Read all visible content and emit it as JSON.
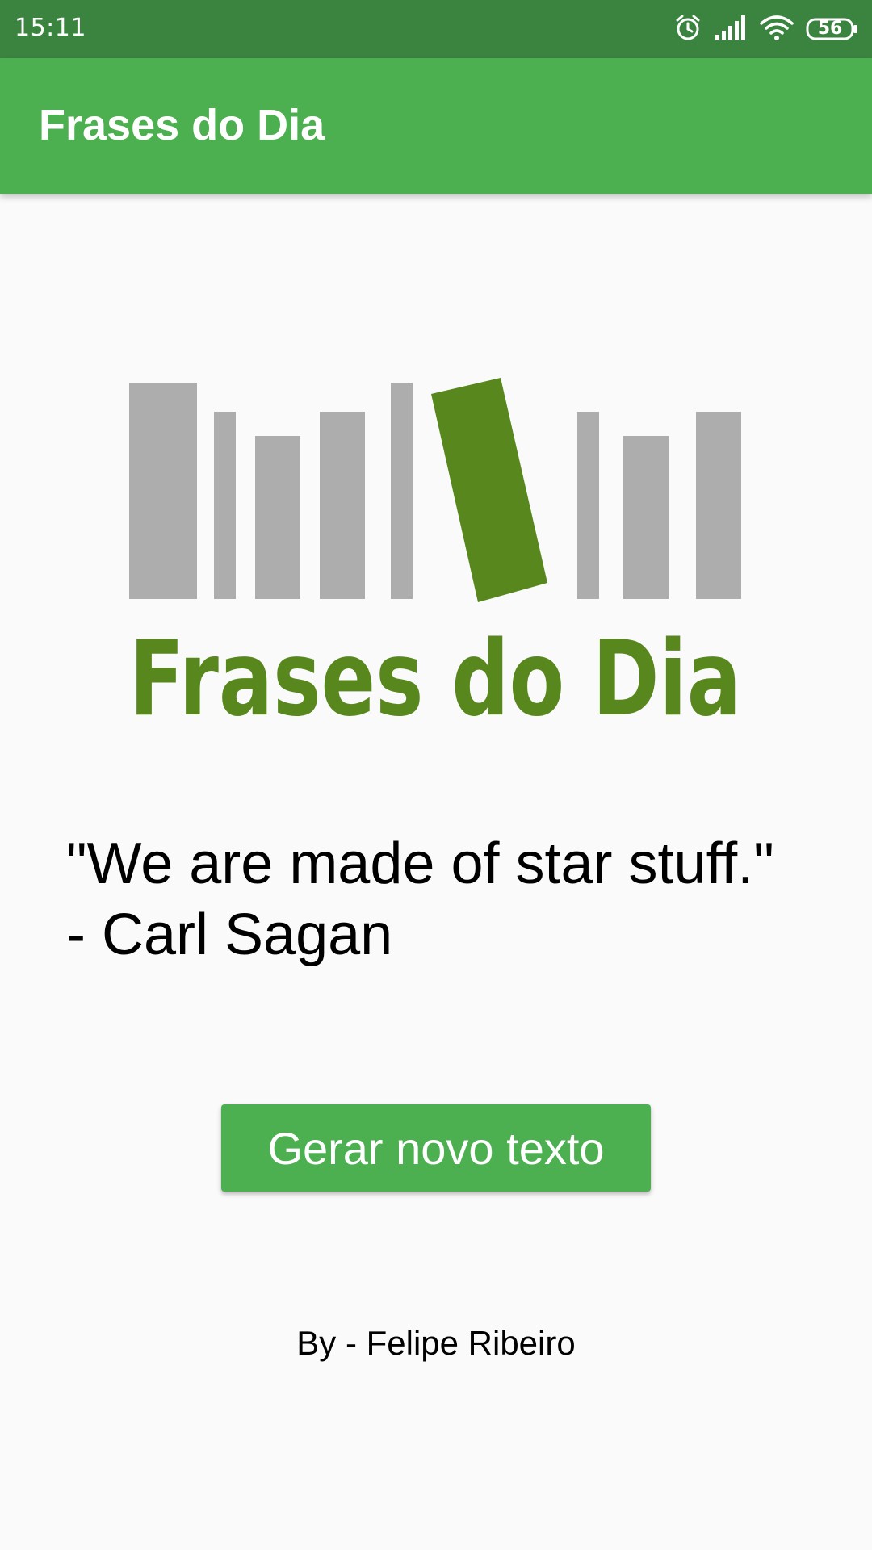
{
  "status_bar": {
    "time": "15:11",
    "battery_level": "56",
    "icons": [
      "alarm-icon",
      "signal-icon",
      "wifi-icon",
      "battery-icon"
    ]
  },
  "app_bar": {
    "title": "Frases do Dia"
  },
  "logo": {
    "text": "Frases do Dia",
    "colors": {
      "books": "#adadad",
      "highlight_book": "#58881d",
      "text": "#58881d"
    }
  },
  "quote": {
    "text": "\"We are made of star stuff.\"",
    "author_line": "- Carl Sagan"
  },
  "generate_button": {
    "label": "Gerar novo texto"
  },
  "footer": {
    "credit": "By - Felipe Ribeiro"
  },
  "colors": {
    "status_bar": "#3a8440",
    "app_bar": "#4caf50",
    "button": "#4caf50",
    "background": "#fafafa"
  }
}
